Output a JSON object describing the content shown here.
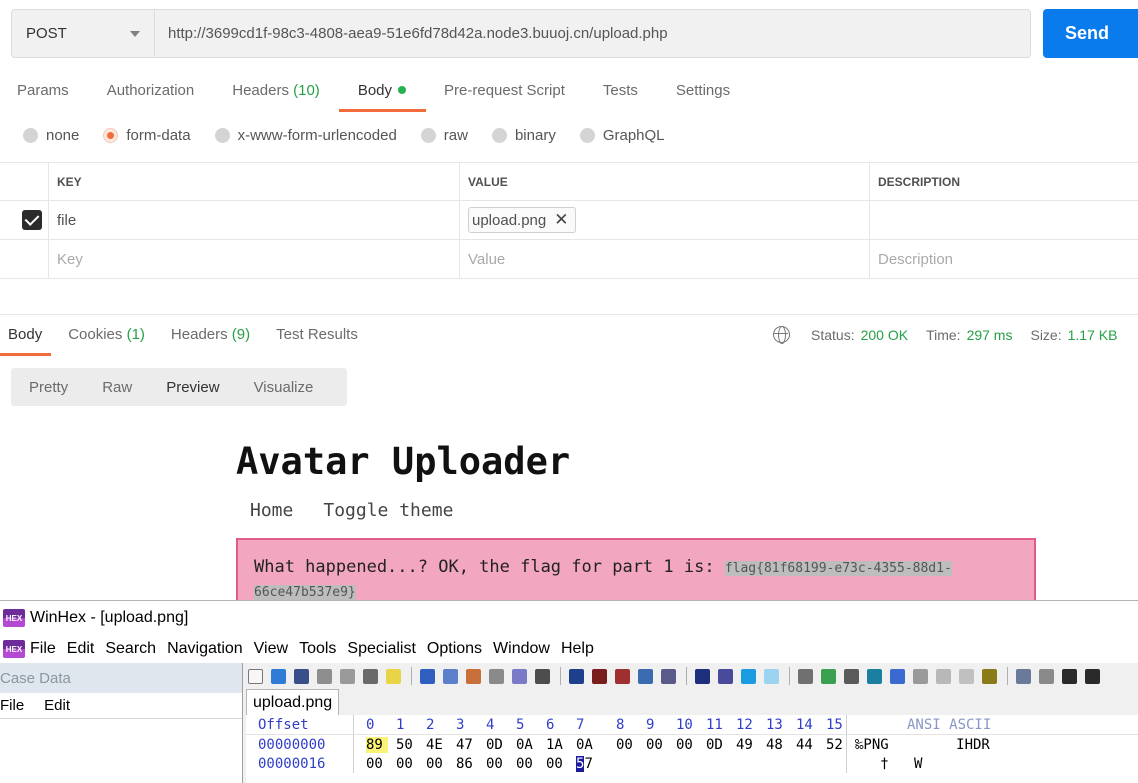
{
  "request": {
    "method": "POST",
    "url": "http://3699cd1f-98c3-4808-aea9-51e6fd78d42a.node3.buuoj.cn/upload.php",
    "send_label": "Send"
  },
  "request_tabs": [
    {
      "label": "Params",
      "count": ""
    },
    {
      "label": "Authorization",
      "count": ""
    },
    {
      "label": "Headers",
      "count": "(10)"
    },
    {
      "label": "Body",
      "count": ""
    },
    {
      "label": "Pre-request Script",
      "count": ""
    },
    {
      "label": "Tests",
      "count": ""
    },
    {
      "label": "Settings",
      "count": ""
    }
  ],
  "body_types": [
    "none",
    "form-data",
    "x-www-form-urlencoded",
    "raw",
    "binary",
    "GraphQL"
  ],
  "form_table": {
    "headers": [
      "KEY",
      "VALUE",
      "DESCRIPTION"
    ],
    "row": {
      "key": "file",
      "value": "upload.png",
      "description": ""
    },
    "placeholders": {
      "key": "Key",
      "value": "Value",
      "description": "Description"
    }
  },
  "response": {
    "tabs": [
      {
        "label": "Body",
        "count": ""
      },
      {
        "label": "Cookies",
        "count": "(1)"
      },
      {
        "label": "Headers",
        "count": "(9)"
      },
      {
        "label": "Test Results",
        "count": ""
      }
    ],
    "status_label": "Status:",
    "status_value": "200 OK",
    "time_label": "Time:",
    "time_value": "297 ms",
    "size_label": "Size:",
    "size_value": "1.17 KB",
    "view_tabs": [
      "Pretty",
      "Raw",
      "Preview",
      "Visualize"
    ]
  },
  "preview": {
    "title": "Avatar Uploader",
    "nav": [
      "Home",
      "Toggle theme"
    ],
    "alert_text": "What happened...? OK, the flag for part 1 is: ",
    "flag_part1": "flag{81f68199-e73c-4355-88d1-",
    "flag_part2": "66ce47b537e9}"
  },
  "winhex": {
    "title": "WinHex - [upload.png]",
    "menu": [
      "File",
      "Edit",
      "Search",
      "Navigation",
      "View",
      "Tools",
      "Specialist",
      "Options",
      "Window",
      "Help"
    ],
    "case_title": "Case Data",
    "case_menu": [
      "File",
      "Edit"
    ],
    "doc_tab": "upload.png",
    "offset_header": "Offset",
    "col_headers": [
      "0",
      "1",
      "2",
      "3",
      "4",
      "5",
      "6",
      "7",
      "8",
      "9",
      "10",
      "11",
      "12",
      "13",
      "14",
      "15"
    ],
    "ascii_header": "ANSI ASCII",
    "rows": [
      {
        "offset": "00000000",
        "bytes": [
          "89",
          "50",
          "4E",
          "47",
          "0D",
          "0A",
          "1A",
          "0A",
          "00",
          "00",
          "00",
          "0D",
          "49",
          "48",
          "44",
          "52"
        ],
        "ascii": "‰PNG        IHDR"
      },
      {
        "offset": "00000016",
        "bytes": [
          "00",
          "00",
          "00",
          "86",
          "00",
          "00",
          "00",
          "57"
        ],
        "ascii": "   †   W"
      }
    ],
    "accent_colors": {
      "postman_orange": "#f26b3a",
      "send_blue": "#097bed",
      "winhex_offset_blue": "#2f3ec8"
    }
  }
}
